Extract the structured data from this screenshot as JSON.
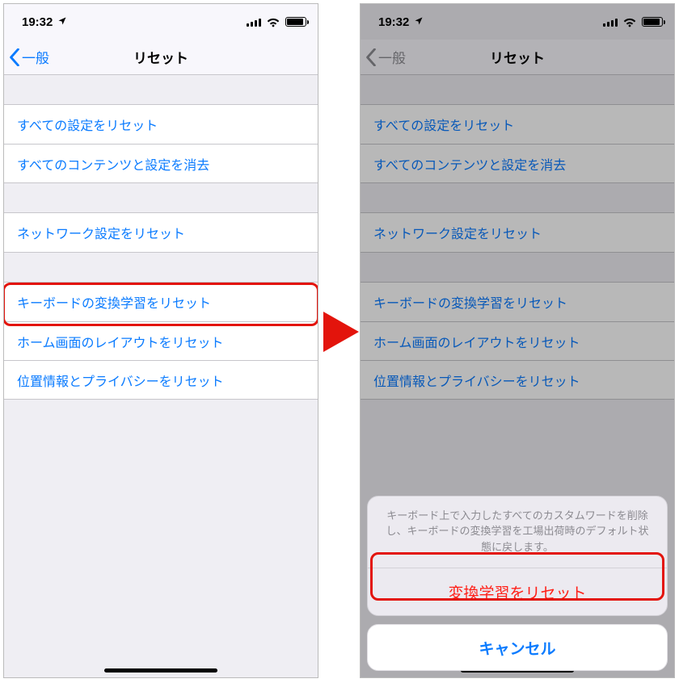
{
  "status": {
    "time": "19:32"
  },
  "nav": {
    "back": "一般",
    "title": "リセット"
  },
  "groups": [
    {
      "rows": [
        "すべての設定をリセット",
        "すべてのコンテンツと設定を消去"
      ]
    },
    {
      "rows": [
        "ネットワーク設定をリセット"
      ]
    },
    {
      "rows": [
        "キーボードの変換学習をリセット",
        "ホーム画面のレイアウトをリセット",
        "位置情報とプライバシーをリセット"
      ]
    }
  ],
  "sheet": {
    "message": "キーボード上で入力したすべてのカスタムワードを削除し、キーボードの変換学習を工場出荷時のデフォルト状態に戻します。",
    "destructive": "変換学習をリセット",
    "cancel": "キャンセル"
  }
}
